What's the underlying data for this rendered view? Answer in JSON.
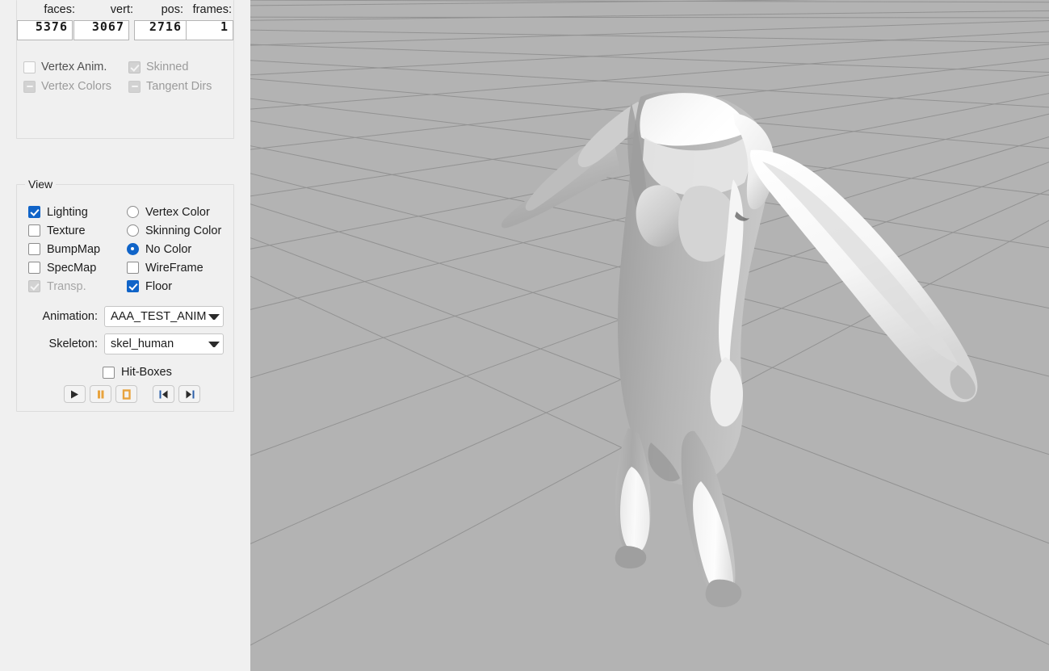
{
  "stats": {
    "labels": {
      "faces": "faces:",
      "vert": "vert:",
      "pos": "pos:",
      "frames": "frames:"
    },
    "values": {
      "faces": "5376",
      "vert": "3067",
      "pos": "2716",
      "frames": "1"
    }
  },
  "mesh_flags": [
    {
      "label": "Vertex Anim.",
      "state": "unchecked",
      "enabled": true
    },
    {
      "label": "Skinned",
      "state": "checked",
      "enabled": false
    },
    {
      "label": "Vertex Colors",
      "state": "indeterminate",
      "enabled": false
    },
    {
      "label": "Tangent Dirs",
      "state": "indeterminate",
      "enabled": false
    }
  ],
  "view": {
    "legend": "View",
    "left_column": [
      {
        "label": "Lighting",
        "checked": true,
        "enabled": true
      },
      {
        "label": "Texture",
        "checked": false,
        "enabled": true
      },
      {
        "label": "BumpMap",
        "checked": false,
        "enabled": true
      },
      {
        "label": "SpecMap",
        "checked": false,
        "enabled": true
      },
      {
        "label": "Transp.",
        "checked": true,
        "enabled": false
      }
    ],
    "right_column": [
      {
        "label": "Vertex Color",
        "type": "radio",
        "selected": false
      },
      {
        "label": "Skinning Color",
        "type": "radio",
        "selected": false
      },
      {
        "label": "No Color",
        "type": "radio",
        "selected": true
      },
      {
        "label": "WireFrame",
        "type": "checkbox",
        "checked": false
      },
      {
        "label": "Floor",
        "type": "checkbox",
        "checked": true
      }
    ],
    "animation_label": "Animation:",
    "animation_value": "AAA_TEST_ANIM",
    "skeleton_label": "Skeleton:",
    "skeleton_value": "skel_human",
    "hitboxes_label": "Hit-Boxes",
    "hitboxes_checked": false,
    "transport": [
      {
        "name": "play-button",
        "glyph": "play"
      },
      {
        "name": "pause-button",
        "glyph": "pause"
      },
      {
        "name": "stop-button",
        "glyph": "stop"
      },
      {
        "name": "first-frame-button",
        "glyph": "prev"
      },
      {
        "name": "last-frame-button",
        "glyph": "next"
      }
    ]
  },
  "colors": {
    "panel_bg": "#f0f0f0",
    "accent": "#1064c8",
    "viewport_bg": "#b3b3b3",
    "grid_line": "#8d8d8d",
    "model_light": "#f4f4f4",
    "model_mid": "#c8c8c8",
    "model_dark": "#a3a3a3",
    "transport_accent": "#e8a33d"
  },
  "viewport": {
    "name": "3d-model-viewport",
    "content": "3D humanoid character mesh on perspective grid floor"
  }
}
